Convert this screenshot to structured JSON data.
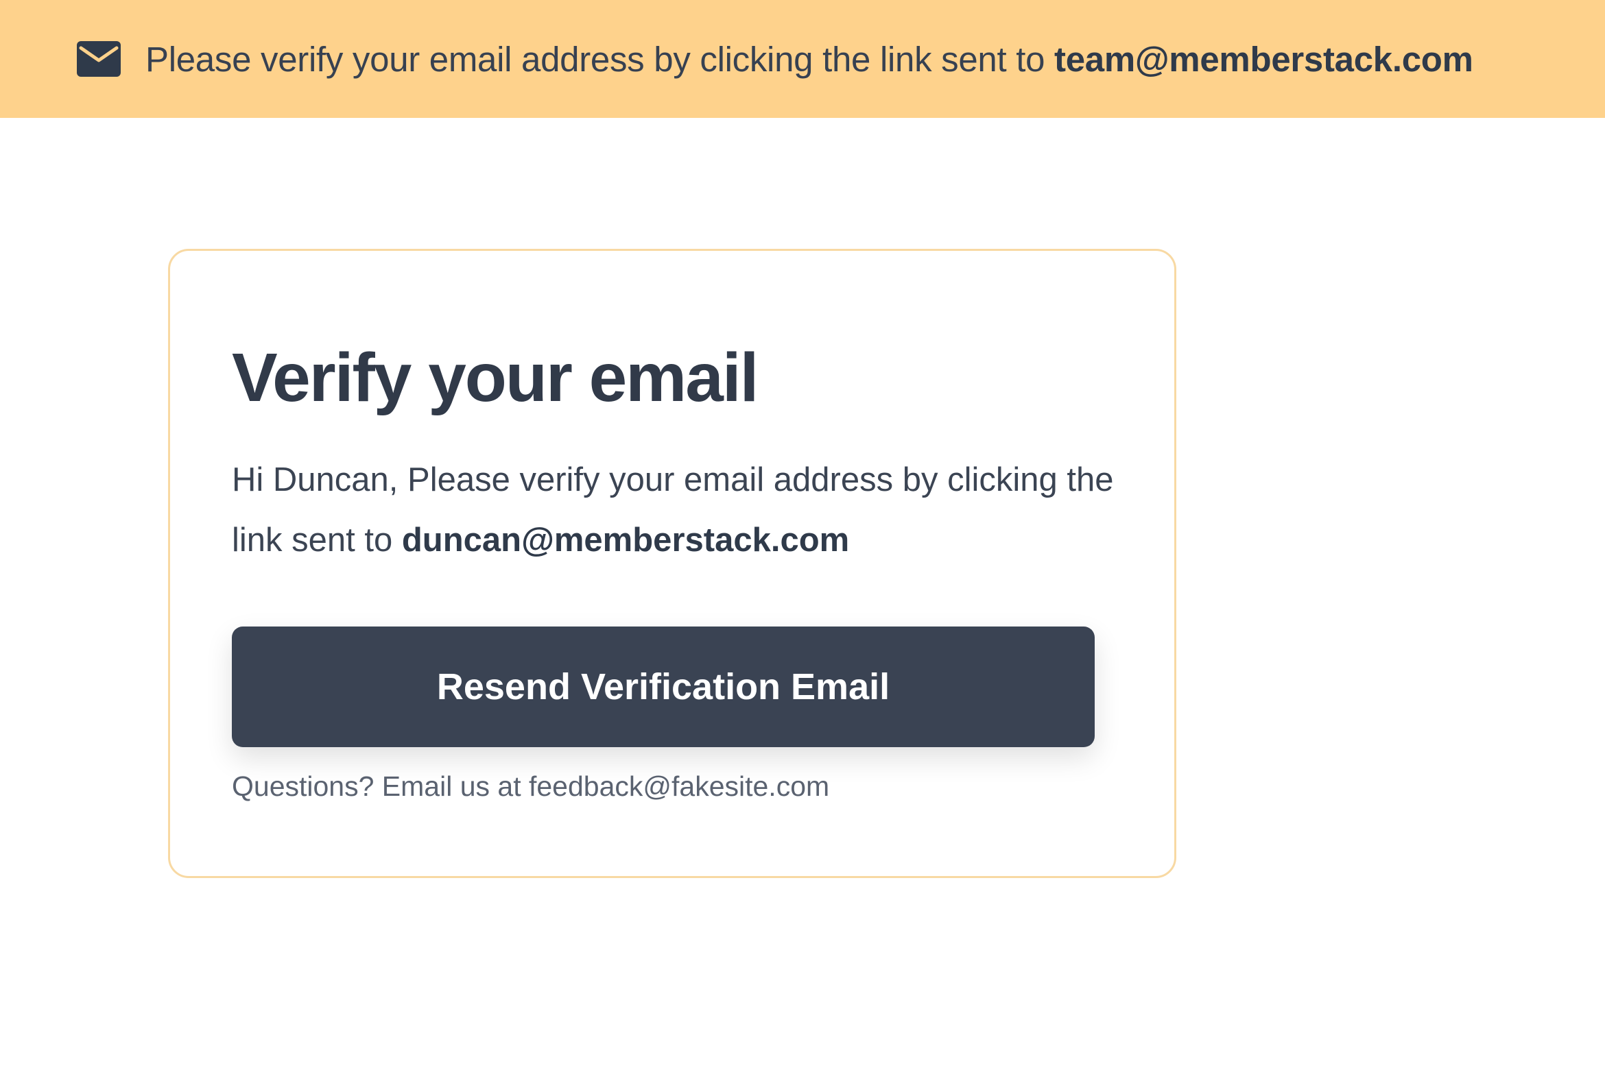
{
  "banner": {
    "icon": "envelope-icon",
    "text_prefix": "Please verify your email address by clicking the link sent to ",
    "email": "team@memberstack.com",
    "background": "#fed28c"
  },
  "card": {
    "title": "Verify your email",
    "body_prefix": "Hi Duncan, Please verify your email address by clicking the link sent to ",
    "body_email": "duncan@memberstack.com",
    "button_label": "Resend Verification Email",
    "help_text": "Questions? Email us at feedback@fakesite.com",
    "border_color": "#f8d9a3",
    "button_color": "#3a4353"
  }
}
